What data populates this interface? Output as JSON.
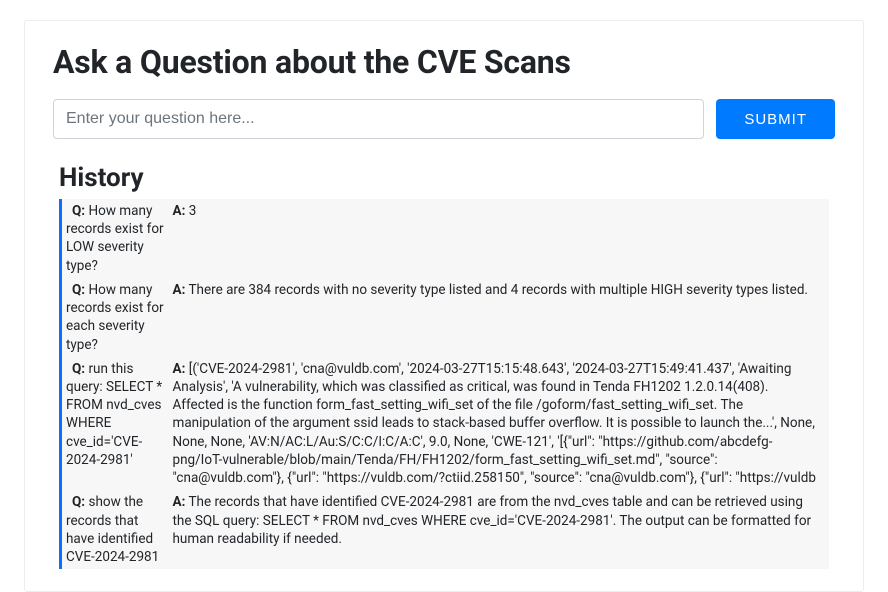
{
  "header": {
    "title": "Ask a Question about the CVE Scans"
  },
  "form": {
    "placeholder": "Enter your question here...",
    "submit_label": "SUBMIT"
  },
  "history": {
    "title": "History",
    "q_prefix": "Q:",
    "a_prefix": "A:",
    "items": [
      {
        "q": "How many records exist for LOW severity type?",
        "a": "3"
      },
      {
        "q": "How many records exist for each severity type?",
        "a": "There are 384 records with no severity type listed and 4 records with multiple HIGH severity types listed."
      },
      {
        "q": "run this query: SELECT * FROM nvd_cves WHERE cve_id='CVE-2024-2981'",
        "a": "[('CVE-2024-2981', 'cna@vuldb.com', '2024-03-27T15:15:48.643', '2024-03-27T15:49:41.437', 'Awaiting Analysis', 'A vulnerability, which was classified as critical, was found in Tenda FH1202 1.2.0.14(408). Affected is the function form_fast_setting_wifi_set of the file /goform/fast_setting_wifi_set. The manipulation of the argument ssid leads to stack-based buffer overflow. It is possible to launch the...', None, None, None, 'AV:N/AC:L/Au:S/C:C/I:C/A:C', 9.0, None, 'CWE-121', '[{\"url\": \"https://github.com/abcdefg-png/IoT-vulnerable/blob/main/Tenda/FH/FH1202/form_fast_setting_wifi_set.md\", \"source\": \"cna@vuldb.com\"}, {\"url\": \"https://vuldb.com/?ctiid.258150\", \"source\": \"cna@vuldb.com\"}, {\"url\": \"https://vuldb"
      },
      {
        "q": "show the records that have identified CVE-2024-2981",
        "a": "The records that have identified CVE-2024-2981 are from the nvd_cves table and can be retrieved using the SQL query: SELECT * FROM nvd_cves WHERE cve_id='CVE-2024-2981'. The output can be formatted for human readability if needed."
      }
    ]
  }
}
